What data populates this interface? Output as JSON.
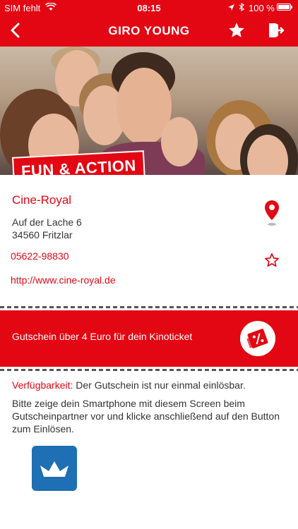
{
  "status_bar": {
    "carrier": "SIM fehlt",
    "time": "08:15",
    "battery": "100 %"
  },
  "nav": {
    "title": "GIRO YOUNG"
  },
  "hero": {
    "badge": "FUN & ACTION"
  },
  "partner": {
    "name": "Cine-Royal",
    "street": "Auf der Lache 6",
    "city": "34560 Fritzlar",
    "phone": "05622-98830",
    "website": "http://www.cine-royal.de"
  },
  "coupon": {
    "text": "Gutschein über 4 Euro für dein Kinoticket"
  },
  "availability": {
    "label": "Verfügbarkeit:",
    "value": "Der Gutschein ist nur einmal einlösbar."
  },
  "instructions": "Bitte zeige dein Smartphone mit diesem Screen beim Gutscheinpartner vor und klicke anschließend auf den Button zum Einlösen.",
  "icons": {
    "back": "chevron-left-icon",
    "favorite_nav": "star-icon",
    "exit": "exit-icon",
    "location": "map-pin-icon",
    "favorite": "star-outline-icon",
    "coupon": "ticket-percent-icon",
    "redeem": "crown-icon"
  },
  "colors": {
    "brand_red": "#e30613",
    "redeem_blue": "#1e6fb3"
  }
}
